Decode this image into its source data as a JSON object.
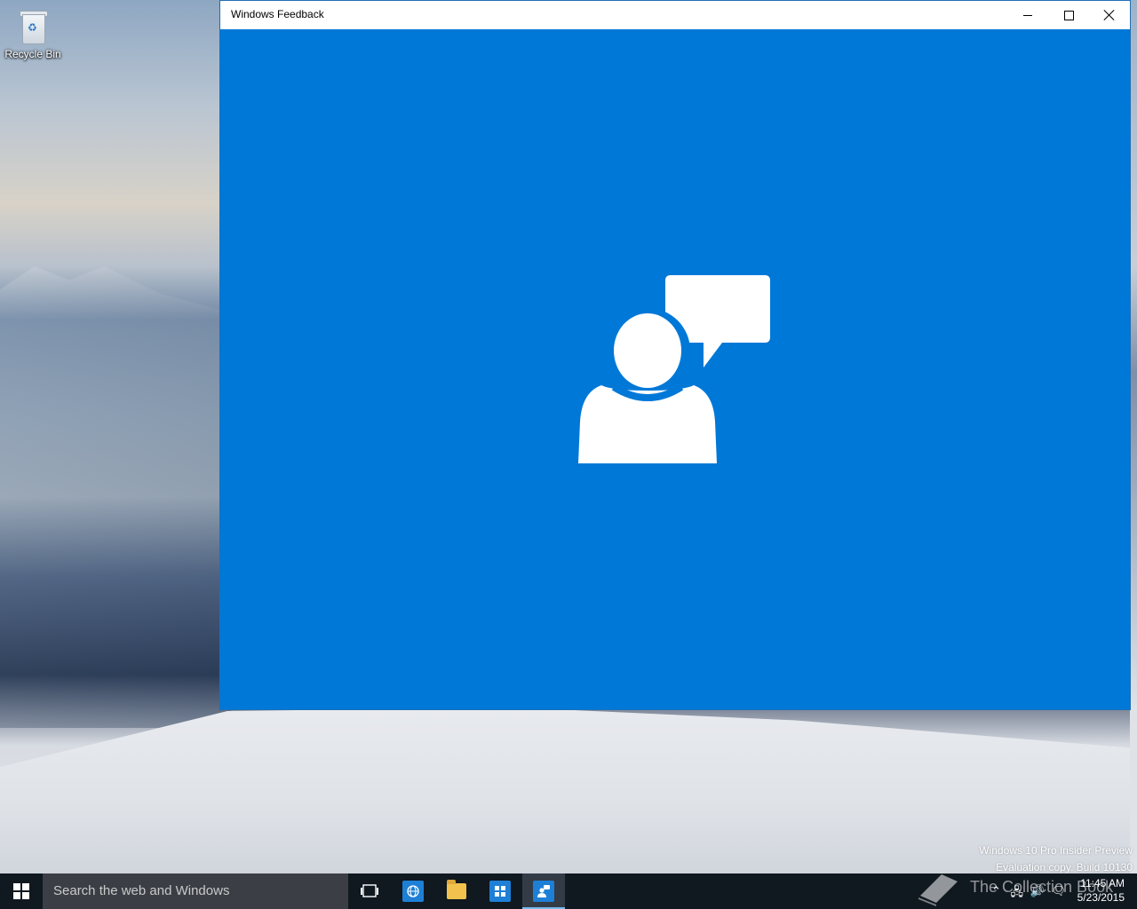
{
  "desktop": {
    "icons": [
      {
        "label": "Recycle Bin"
      }
    ]
  },
  "window": {
    "title": "Windows Feedback",
    "accent_color": "#0078d7",
    "splash_icon": "feedback-person-speech-icon"
  },
  "watermark": {
    "line1": "Windows 10 Pro Insider Preview",
    "line2": "Evaluation copy. Build 10130"
  },
  "taskbar": {
    "search_placeholder": "Search the web and Windows",
    "pinned": [
      {
        "name": "task-view",
        "icon": "task-view-icon"
      },
      {
        "name": "internet-explorer",
        "icon": "ie-icon"
      },
      {
        "name": "file-explorer",
        "icon": "folder-icon"
      },
      {
        "name": "store",
        "icon": "store-icon"
      },
      {
        "name": "windows-feedback",
        "icon": "feedback-icon",
        "active": true
      }
    ],
    "clock": {
      "time": "11:45 AM",
      "date": "5/23/2015"
    },
    "brand_text": "The Collection Book"
  }
}
